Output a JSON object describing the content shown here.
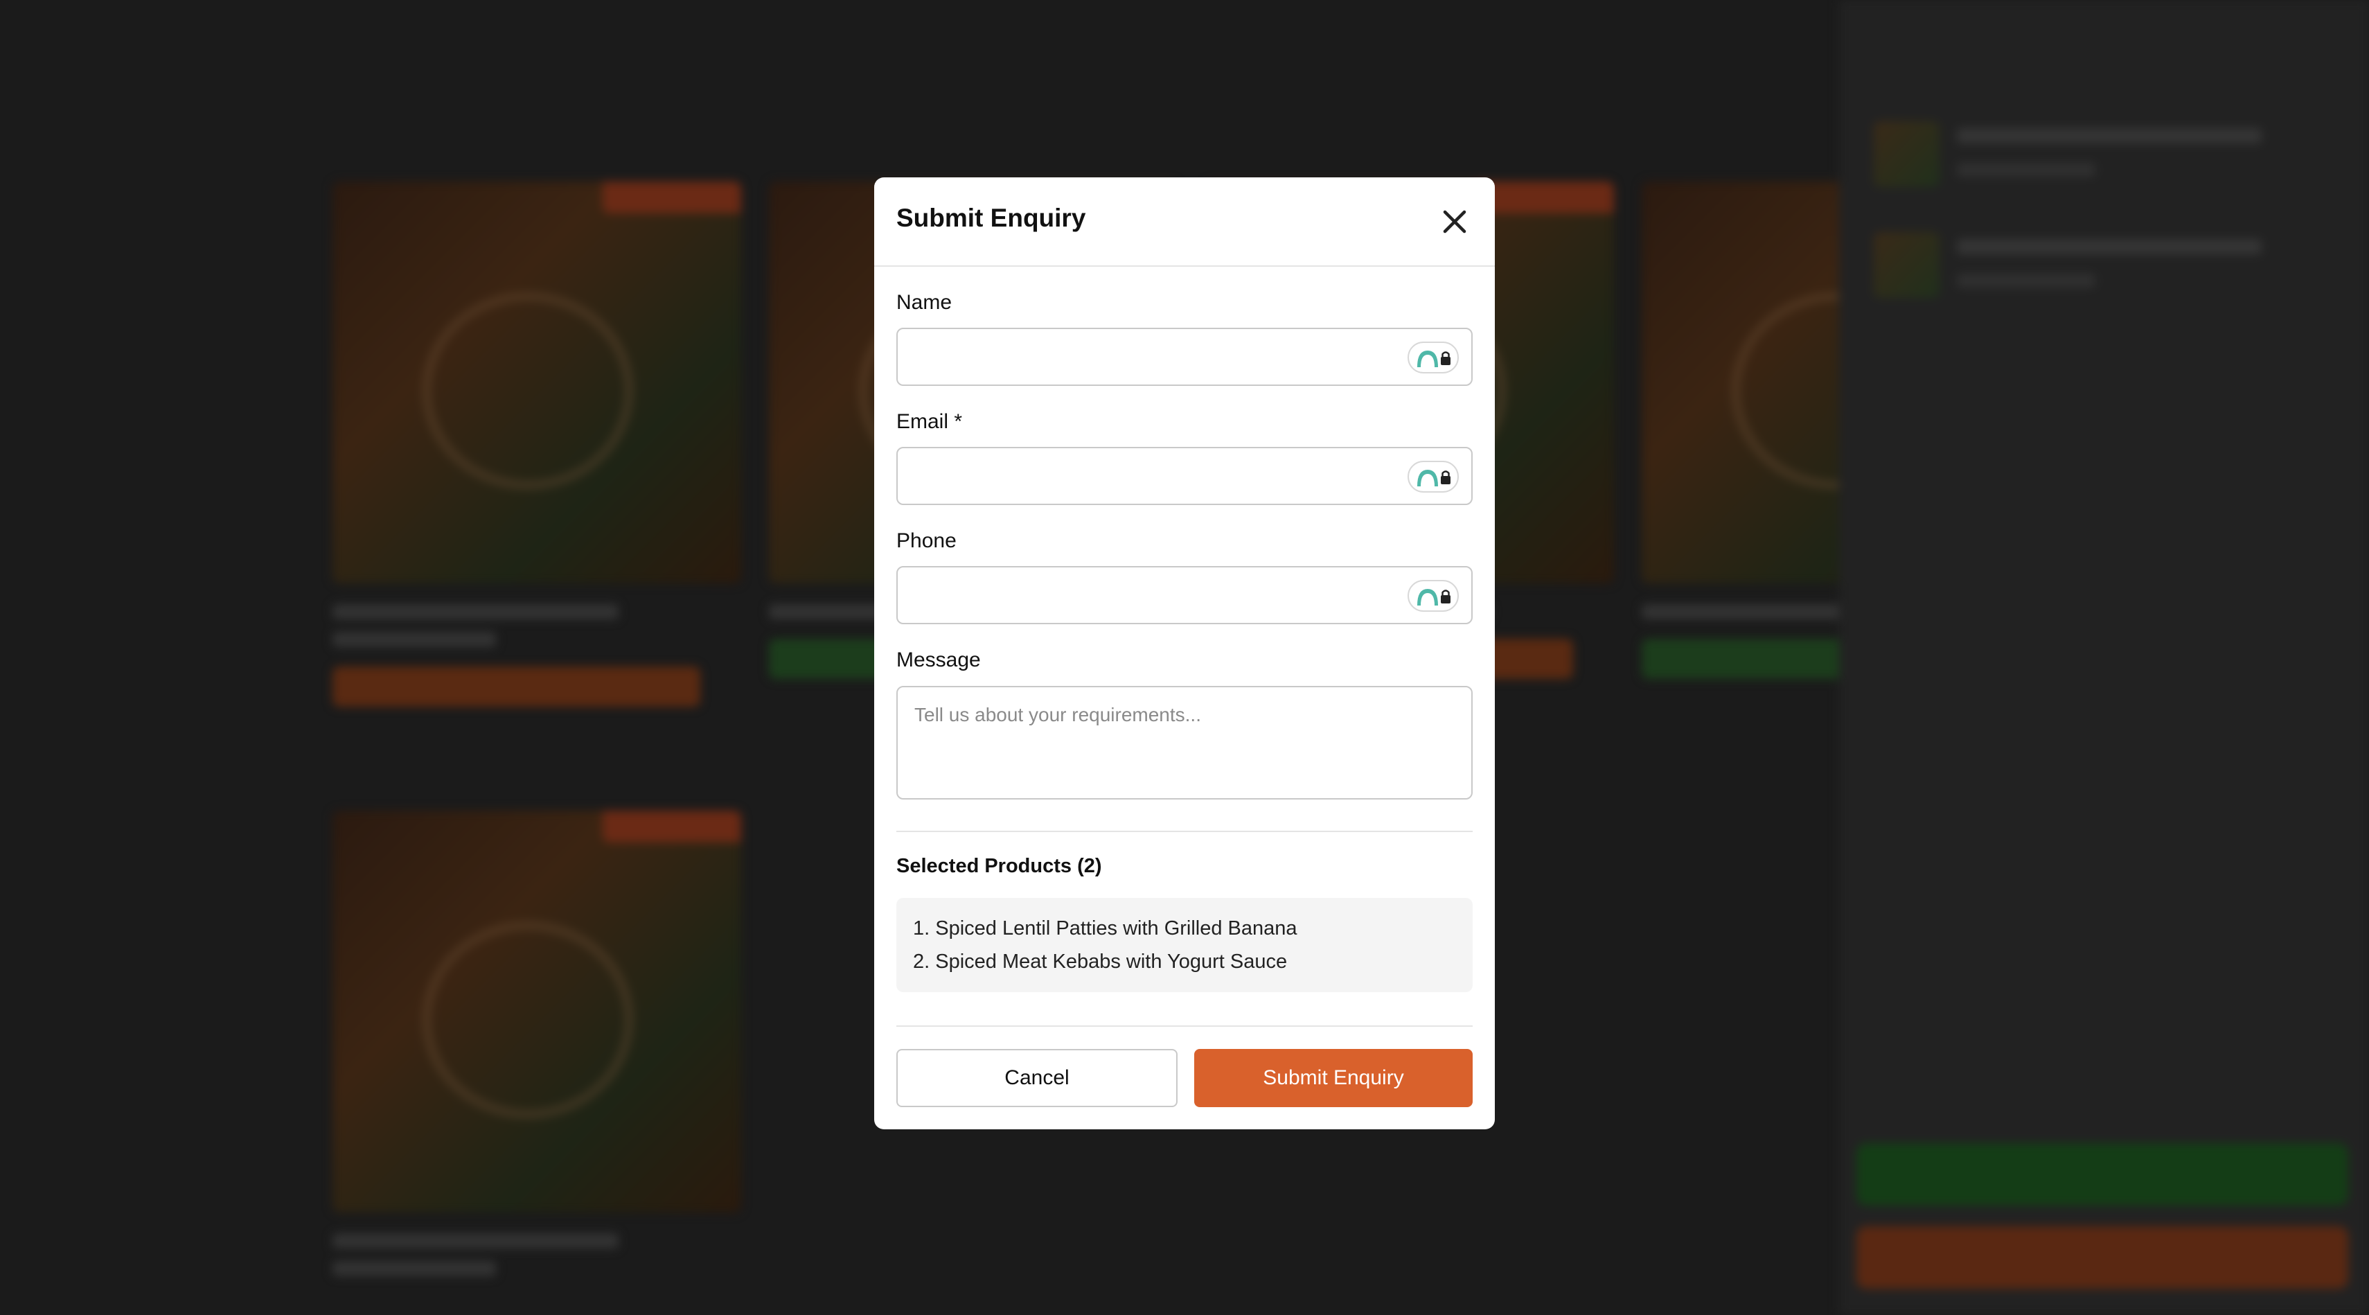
{
  "modal": {
    "title": "Submit Enquiry",
    "fields": {
      "name": {
        "label": "Name",
        "value": ""
      },
      "email": {
        "label": "Email *",
        "value": ""
      },
      "phone": {
        "label": "Phone",
        "value": ""
      },
      "message": {
        "label": "Message",
        "placeholder": "Tell us about your requirements...",
        "value": ""
      }
    },
    "selected_products": {
      "heading": "Selected Products (2)",
      "items": [
        "1. Spiced Lentil Patties with Grilled Banana",
        "2. Spiced Meat Kebabs with Yogurt Sauce"
      ]
    },
    "cancel_label": "Cancel",
    "submit_label": "Submit Enquiry"
  },
  "icons": {
    "close": "close-icon",
    "password_manager": "password-manager-lock-icon"
  },
  "colors": {
    "accent": "#d9612c",
    "overlay": "#1b1b1b",
    "badge_teal": "#4fb8a8"
  }
}
